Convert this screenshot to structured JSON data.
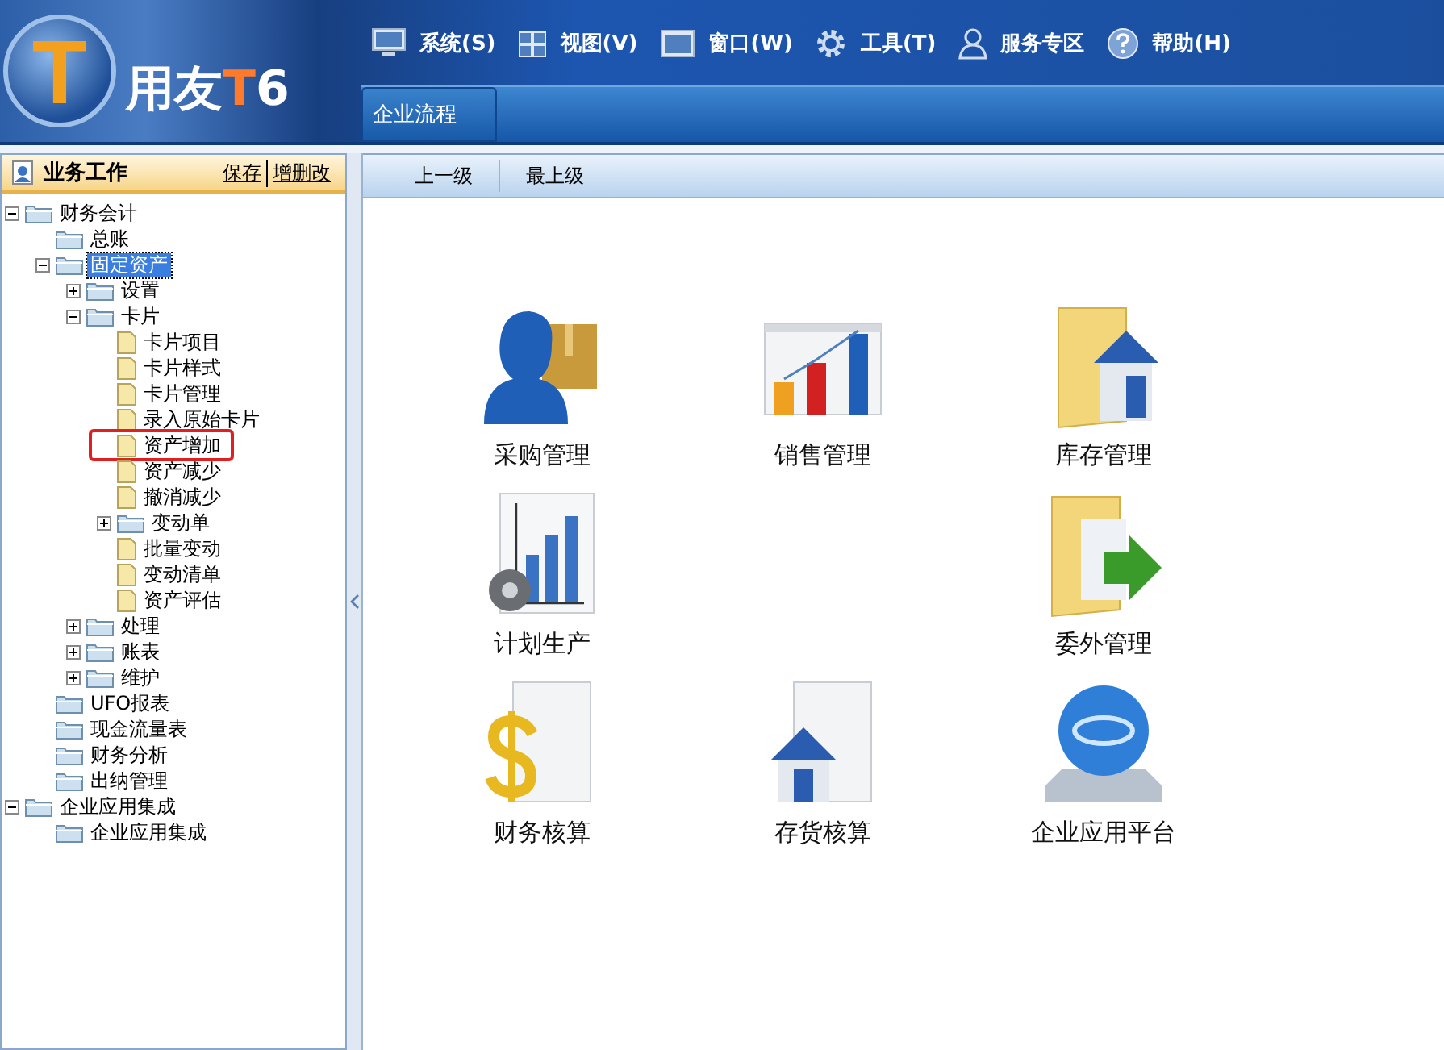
{
  "app_header": {
    "logo": {
      "badge": "T",
      "wordmark": [
        {
          "text": "用友",
          "accent": false
        },
        {
          "text": "T",
          "accent": true
        },
        {
          "text": "6",
          "accent": false
        }
      ]
    },
    "menu": [
      {
        "label": "系统(S)",
        "kind": "monitor"
      },
      {
        "label": "视图(V)",
        "kind": "grid"
      },
      {
        "label": "窗口(W)",
        "kind": "window"
      },
      {
        "label": "工具(T)",
        "kind": "gear"
      },
      {
        "label": "服务专区",
        "kind": "person"
      },
      {
        "label": "帮助(H)",
        "kind": "help"
      }
    ],
    "tabs": [
      {
        "label": "企业流程",
        "selected": true
      }
    ]
  },
  "sidebar": {
    "title": "业务工作",
    "links": [
      "保存",
      "增删改"
    ],
    "tree": [
      {
        "label": "财务会计",
        "kind": "folder",
        "expanded": true,
        "selected": false,
        "marked": false,
        "children": [
          {
            "label": "总账",
            "kind": "folder",
            "selected": false,
            "marked": false
          },
          {
            "label": "固定资产",
            "kind": "folder",
            "expanded": true,
            "selected": true,
            "marked": false,
            "children": [
              {
                "label": "设置",
                "kind": "folder",
                "expanded": false,
                "selected": false,
                "marked": false
              },
              {
                "label": "卡片",
                "kind": "folder",
                "expanded": true,
                "selected": false,
                "marked": false,
                "children": [
                  {
                    "label": "卡片项目",
                    "kind": "document",
                    "selected": false,
                    "marked": false
                  },
                  {
                    "label": "卡片样式",
                    "kind": "document",
                    "selected": false,
                    "marked": false
                  },
                  {
                    "label": "卡片管理",
                    "kind": "document",
                    "selected": false,
                    "marked": false
                  },
                  {
                    "label": "录入原始卡片",
                    "kind": "document",
                    "selected": false,
                    "marked": false
                  },
                  {
                    "label": "资产增加",
                    "kind": "document",
                    "selected": false,
                    "marked": true
                  },
                  {
                    "label": "资产减少",
                    "kind": "document",
                    "selected": false,
                    "marked": false
                  },
                  {
                    "label": "撤消减少",
                    "kind": "document",
                    "selected": false,
                    "marked": false
                  },
                  {
                    "label": "变动单",
                    "kind": "folder",
                    "expanded": false,
                    "selected": false,
                    "marked": false
                  },
                  {
                    "label": "批量变动",
                    "kind": "document",
                    "selected": false,
                    "marked": false
                  },
                  {
                    "label": "变动清单",
                    "kind": "document",
                    "selected": false,
                    "marked": false
                  },
                  {
                    "label": "资产评估",
                    "kind": "document",
                    "selected": false,
                    "marked": false
                  }
                ]
              },
              {
                "label": "处理",
                "kind": "folder",
                "expanded": false,
                "selected": false,
                "marked": false
              },
              {
                "label": "账表",
                "kind": "folder",
                "expanded": false,
                "selected": false,
                "marked": false
              },
              {
                "label": "维护",
                "kind": "folder",
                "expanded": false,
                "selected": false,
                "marked": false
              }
            ]
          },
          {
            "label": "UFO报表",
            "kind": "folder",
            "selected": false,
            "marked": false
          },
          {
            "label": "现金流量表",
            "kind": "folder",
            "selected": false,
            "marked": false
          },
          {
            "label": "财务分析",
            "kind": "folder",
            "selected": false,
            "marked": false
          },
          {
            "label": "出纳管理",
            "kind": "folder",
            "selected": false,
            "marked": false
          }
        ]
      },
      {
        "label": "企业应用集成",
        "kind": "folder",
        "expanded": true,
        "selected": false,
        "marked": false,
        "children": [
          {
            "label": "企业应用集成",
            "kind": "folder",
            "selected": false,
            "marked": false
          }
        ]
      }
    ]
  },
  "toolbar": {
    "buttons": [
      "上一级",
      "最上级"
    ]
  },
  "modules": [
    {
      "items": [
        {
          "label": "采购管理",
          "kind": "purchase"
        },
        {
          "label": "销售管理",
          "kind": "sales"
        },
        {
          "label": "库存管理",
          "kind": "inventory"
        }
      ]
    },
    {
      "items": [
        {
          "label": "计划生产",
          "kind": "planning"
        },
        {
          "label": "委外管理",
          "kind": "outsourcing"
        }
      ]
    },
    {
      "items": [
        {
          "label": "财务核算",
          "kind": "finance"
        },
        {
          "label": "存货核算",
          "kind": "stock"
        },
        {
          "label": "企业应用平台",
          "kind": "platform"
        }
      ]
    }
  ]
}
